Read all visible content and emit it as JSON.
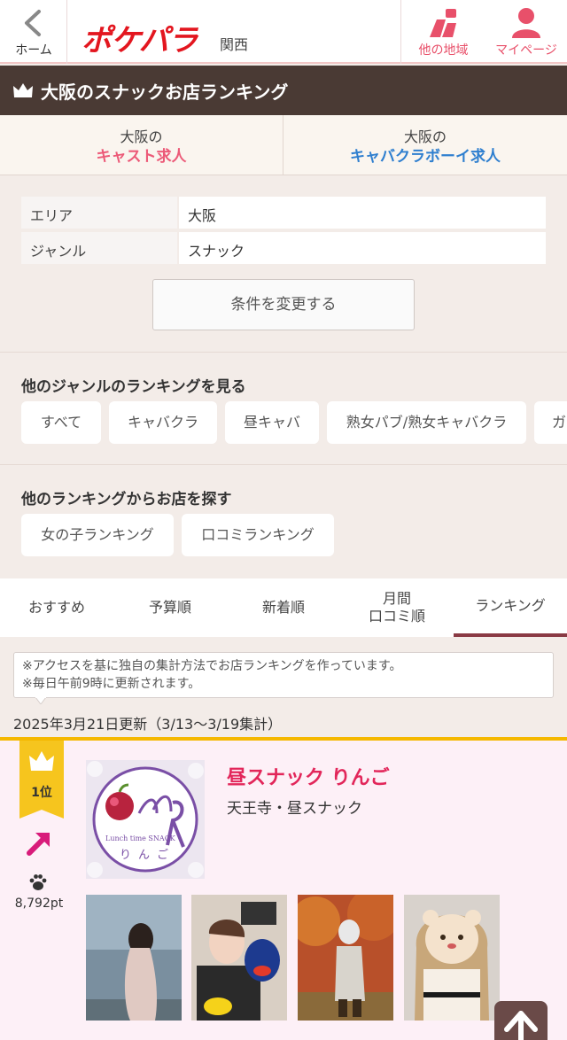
{
  "header": {
    "home_label": "ホーム",
    "logo_text": "ポケパラ",
    "region": "関西",
    "other_area_label": "他の地域",
    "mypage_label": "マイページ"
  },
  "title": "大阪のスナックお店ランキング",
  "jobs": [
    {
      "top": "大阪の",
      "label": "キャスト求人",
      "color": "#ec5a78"
    },
    {
      "top": "大阪の",
      "label": "キャバクラボーイ求人",
      "color": "#2f7fcf"
    }
  ],
  "filter": {
    "rows": [
      {
        "key": "エリア",
        "value": "大阪"
      },
      {
        "key": "ジャンル",
        "value": "スナック"
      }
    ],
    "change_label": "条件を変更する"
  },
  "genres": {
    "title": "他のジャンルのランキングを見る",
    "chips": [
      "すべて",
      "キャバクラ",
      "昼キャバ",
      "熟女パブ/熟女キャバクラ",
      "ガ"
    ]
  },
  "other_rankings": {
    "title": "他のランキングからお店を探す",
    "chips": [
      "女の子ランキング",
      "口コミランキング"
    ]
  },
  "tabs": [
    {
      "label": "おすすめ"
    },
    {
      "label": "予算順"
    },
    {
      "label": "新着順"
    },
    {
      "label_line1": "月間",
      "label_line2": "口コミ順"
    },
    {
      "label": "ランキング",
      "active": true
    }
  ],
  "info": {
    "line1": "※アクセスを基に独自の集計方法でお店ランキングを作っています。",
    "line2": "※毎日午前9時に更新されます。"
  },
  "updated": "2025年3月21日更新（3/13〜3/19集計）",
  "ranking": [
    {
      "rank": "1位",
      "points": "8,792pt",
      "trend": "up",
      "shop_name": "昼スナック りんご",
      "shop_sub": "天王寺・昼スナック",
      "logo_caption": "Lunch time SNACK",
      "logo_kana": "りんご"
    }
  ],
  "colors": {
    "accent_pink": "#ec5a78",
    "brand_red": "#e3161f",
    "title_bar": "#4a3a34",
    "rank_gold": "#f6c51e"
  }
}
